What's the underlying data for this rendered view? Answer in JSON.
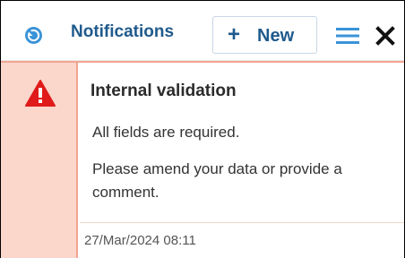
{
  "header": {
    "title": "Notifications",
    "new_button_plus": "+",
    "new_button_label": "New",
    "app_icon": "clock-back-icon",
    "menu_icon": "hamburger-menu-icon",
    "close_icon": "close-icon"
  },
  "notification": {
    "severity_icon": "warning-triangle-icon",
    "title": "Internal validation",
    "message_line1": "All fields are required.",
    "message_line2": "Please amend your data or provide a comment.",
    "timestamp": "27/Mar/2024 08:11"
  },
  "colors": {
    "brand_blue": "#1f5a8c",
    "icon_blue": "#3a93d8",
    "warning_red": "#e01a1a",
    "notif_border": "#f2a48f",
    "notif_strip": "#fbd6cb"
  }
}
